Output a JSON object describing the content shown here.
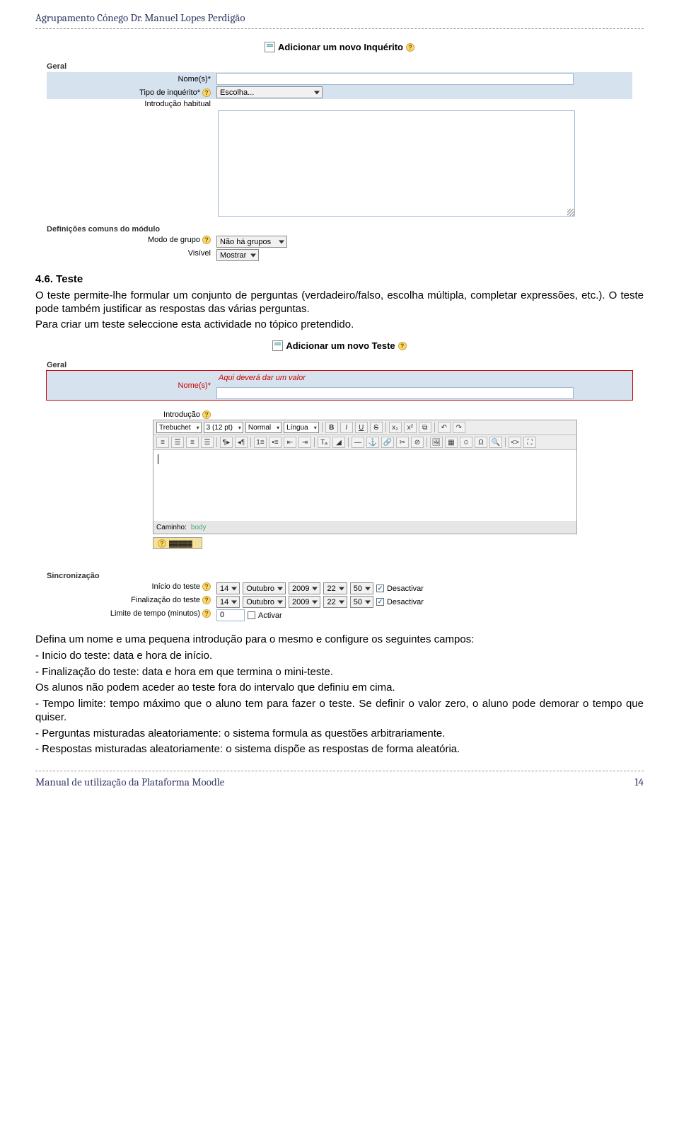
{
  "header": {
    "title": "Agrupamento Cónego Dr. Manuel Lopes Perdigão"
  },
  "footer": {
    "left": "Manual de utilização da Plataforma Moodle",
    "right": "14"
  },
  "inq": {
    "heading": "Adicionar um novo Inquérito",
    "legend_geral": "Geral",
    "nome_label": "Nome(s)*",
    "tipo_label": "Tipo de inquérito*",
    "tipo_value": "Escolha...",
    "intro_label": "Introdução habitual",
    "legend_def": "Definições comuns do módulo",
    "modo_grupo_label": "Modo de grupo",
    "modo_grupo_value": "Não há grupos",
    "visivel_label": "Visível",
    "visivel_value": "Mostrar"
  },
  "body1": {
    "h": "4.6. Teste",
    "p1": "O teste permite-lhe formular um conjunto de perguntas (verdadeiro/falso, escolha múltipla, completar expressões, etc.). O teste pode também justificar as respostas das várias perguntas.",
    "p2": "Para criar um teste seleccione esta actividade no tópico pretendido."
  },
  "teste": {
    "heading": "Adicionar um novo Teste",
    "legend_geral": "Geral",
    "nome_label": "Nome(s)*",
    "nome_placeholder": "Aqui deverá dar um valor",
    "intro_label": "Introdução",
    "font": "Trebuchet",
    "size": "3 (12 pt)",
    "format": "Normal",
    "lang": "Língua",
    "path_label": "Caminho:",
    "path_value": "body",
    "toggle": "?"
  },
  "sync": {
    "legend": "Sincronização",
    "inicio_label": "Início do teste",
    "final_label": "Finalização do teste",
    "limite_label": "Limite de tempo (minutos)",
    "dia": "14",
    "mes": "Outubro",
    "ano": "2009",
    "hh": "22",
    "mm": "50",
    "desactivar": "Desactivar",
    "activar": "Activar",
    "limite_value": "0"
  },
  "body2": {
    "p1": "Defina um nome e uma pequena introdução para o mesmo e configure os seguintes campos:",
    "l1": "- Inicio do teste: data e hora de início.",
    "l2": "- Finalização do teste: data e hora em que termina o mini-teste.",
    "l3": "Os alunos não podem aceder ao teste fora do intervalo que definiu em cima.",
    "l4": "- Tempo limite: tempo máximo que o aluno tem para fazer o teste. Se definir o valor zero, o aluno pode demorar o tempo que quiser.",
    "l5": "- Perguntas misturadas aleatoriamente: o sistema formula as questões arbitrariamente.",
    "l6": "- Respostas misturadas aleatoriamente: o sistema dispõe as respostas de forma aleatória."
  }
}
